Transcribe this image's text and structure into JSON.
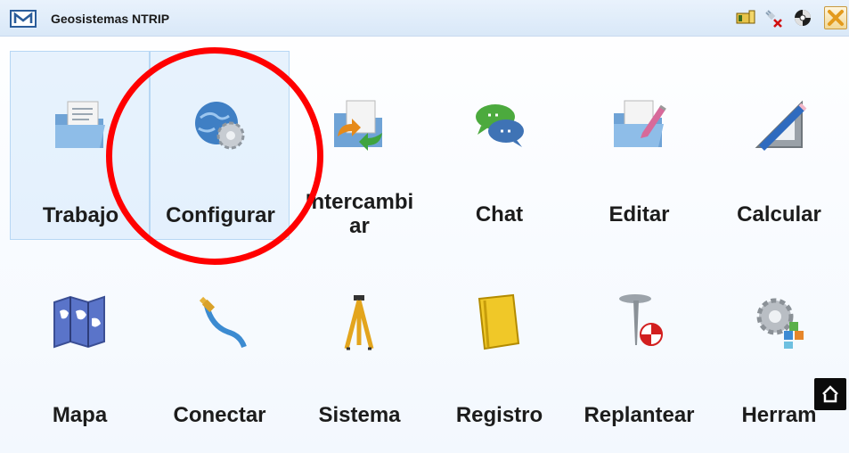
{
  "app": {
    "title": "Geosistemas NTRIP"
  },
  "titlebar": {
    "icons": [
      "battery-radio-icon",
      "satellite-disconnected-icon",
      "gnss-status-icon",
      "close-icon"
    ]
  },
  "menu": {
    "items": [
      {
        "label": "Trabajo",
        "icon": "folder-document-icon"
      },
      {
        "label": "Configurar",
        "icon": "globe-gear-icon"
      },
      {
        "label": "Intercambi\nar",
        "icon": "folder-exchange-icon"
      },
      {
        "label": "Chat",
        "icon": "chat-bubbles-icon"
      },
      {
        "label": "Editar",
        "icon": "folder-edit-icon"
      },
      {
        "label": "Calcular",
        "icon": "ruler-pencil-icon"
      },
      {
        "label": "Mapa",
        "icon": "world-map-icon"
      },
      {
        "label": "Conectar",
        "icon": "cable-icon"
      },
      {
        "label": "Sistema",
        "icon": "tripod-icon"
      },
      {
        "label": "Registro",
        "icon": "logbook-icon"
      },
      {
        "label": "Replantear",
        "icon": "stakeout-pin-icon"
      },
      {
        "label": "Herram",
        "icon": "tools-gear-icon"
      }
    ]
  },
  "colors": {
    "highlight_circle": "#ff0000",
    "accent_border": "#2a5c9a"
  }
}
